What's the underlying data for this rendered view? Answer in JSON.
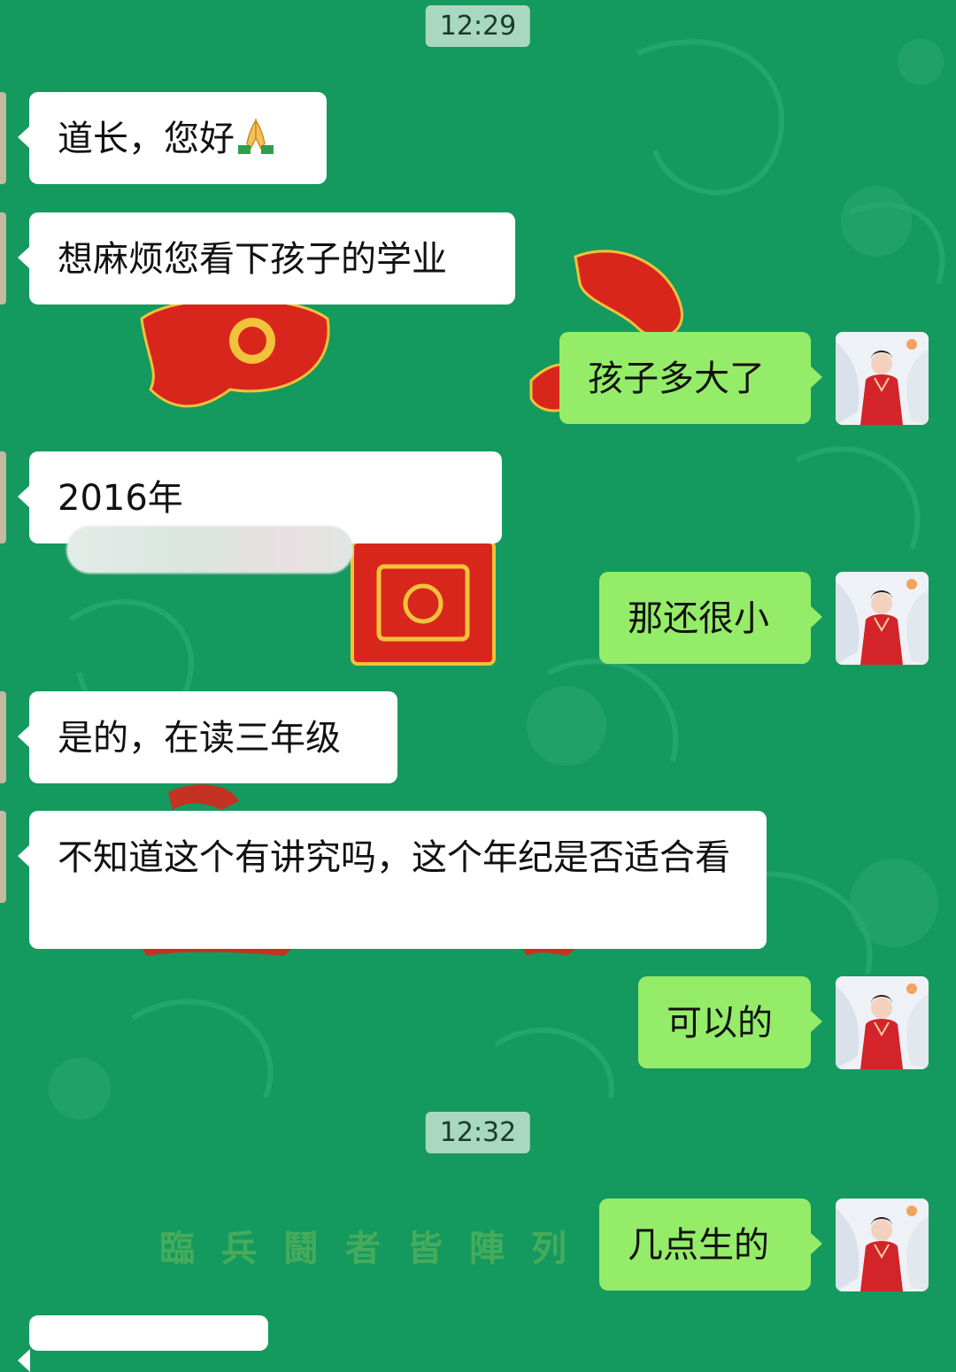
{
  "timestamps": [
    "12:29",
    "12:32"
  ],
  "messages": [
    {
      "side": "left",
      "text": "道长，您好"
    },
    {
      "side": "left",
      "text": "想麻烦您看下孩子的学业"
    },
    {
      "side": "right",
      "text": "孩子多大了"
    },
    {
      "side": "left",
      "text": "2016年"
    },
    {
      "side": "right",
      "text": "那还很小"
    },
    {
      "side": "left",
      "text": "是的，在读三年级"
    },
    {
      "side": "left",
      "text": "不知道这个有讲究吗，这个年纪是否适合看"
    },
    {
      "side": "right",
      "text": "可以的"
    },
    {
      "side": "right",
      "text": "几点生的"
    }
  ],
  "background": {
    "caption": "臨兵鬪者皆陣列",
    "color": "#149a5e"
  },
  "colors": {
    "incoming_bubble": "#ffffff",
    "outgoing_bubble": "#95ec69",
    "timestamp_bg": "#a8d8c0"
  },
  "icons": {
    "greeting_emoji": "folded-hands-icon",
    "self_avatar": "red-robed-figure-avatar"
  }
}
